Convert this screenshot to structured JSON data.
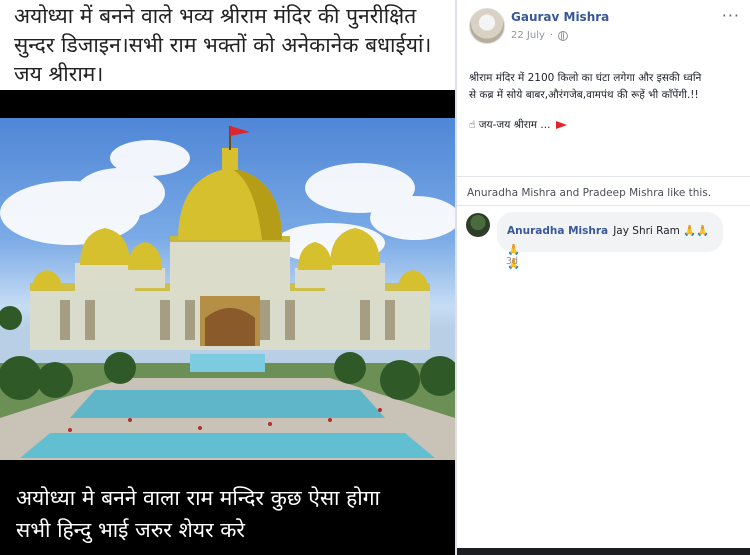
{
  "image_panel": {
    "caption_top_lines": [
      "अयोध्या में बनने वाले भव्य श्रीराम मंदिर की पुनरीक्षित",
      "सुन्दर डिजाइन।सभी राम भक्तों को अनेकानेक बधाईयां।",
      "जय श्रीराम।"
    ],
    "caption_bottom_lines": [
      "अयोध्या मे बनने वाला राम मन्दिर कुछ ऐसा होगा",
      "सभी हिन्दु भाई जरुर शेयर करे"
    ]
  },
  "post": {
    "author": "Gaurav Mishra",
    "date": "22 July",
    "more_label": "···",
    "text_lines": [
      "श्रीराम मंदिर में 2100 किलो का घंटा लगेगा और इसकी ध्वनि",
      "से कब्र में सोये बाबर,औरंगजेब,वामपंथ की रूहें भी काँपेंगी.!!"
    ],
    "tag_line": "☝ जय-जय श्रीराम ...",
    "likes": "Anuradha Mishra and Pradeep Mishra like this.",
    "comment": {
      "name": "Anuradha Mishra",
      "text": "Jay Shri Ram 🙏🙏🙏",
      "text_wrap": "🙏",
      "time": "3d"
    }
  },
  "colors": {
    "link": "#385898",
    "flag": "#e0242b",
    "gold": "#d8c23a"
  }
}
